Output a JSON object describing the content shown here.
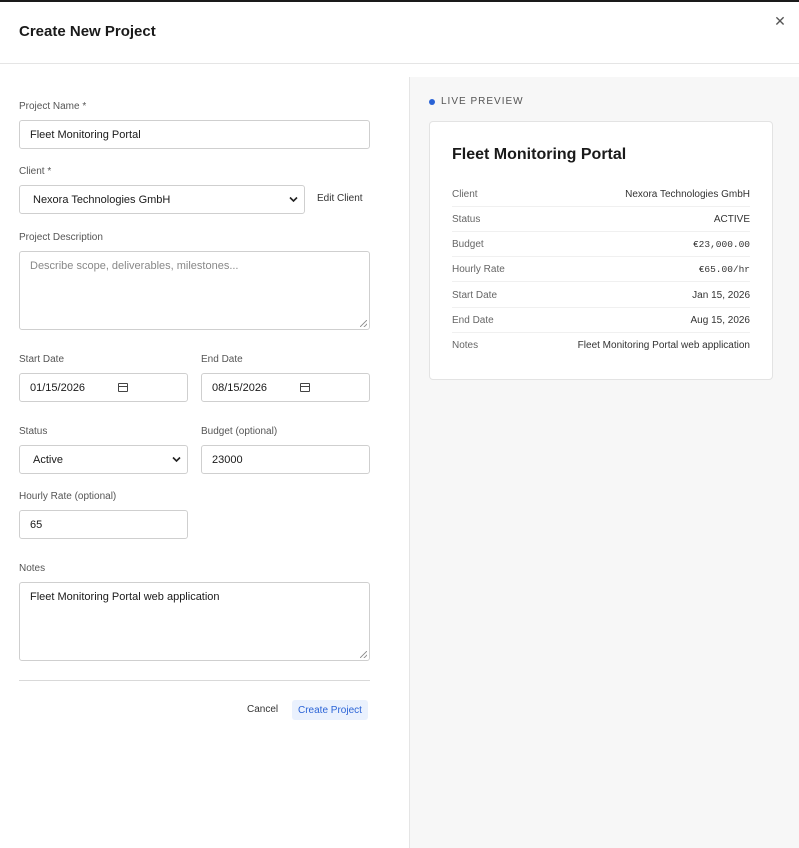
{
  "dialog": {
    "title": "Create New Project",
    "close_icon": "close-icon"
  },
  "form": {
    "project_name": {
      "label": "Project Name *",
      "value": "Fleet Monitoring Portal"
    },
    "client": {
      "label": "Client *",
      "value": "Nexora Technologies GmbH",
      "edit_label": "Edit Client"
    },
    "description": {
      "label": "Project Description",
      "placeholder": "Describe scope, deliverables, milestones..."
    },
    "start_date": {
      "label": "Start Date",
      "value": "01/15/2026"
    },
    "end_date": {
      "label": "End Date",
      "value": "08/15/2026"
    },
    "status": {
      "label": "Status",
      "value": "Active"
    },
    "budget": {
      "label": "Budget (optional)",
      "value": "23000"
    },
    "hourly_rate": {
      "label": "Hourly Rate (optional)",
      "value": "65"
    },
    "notes": {
      "label": "Notes",
      "value": "Fleet Monitoring Portal web application"
    },
    "cancel_label": "Cancel",
    "create_label": "Create Project"
  },
  "preview": {
    "label": "LIVE PREVIEW",
    "title": "Fleet Monitoring Portal",
    "rows": [
      {
        "key": "Client",
        "value": "Nexora Technologies GmbH"
      },
      {
        "key": "Status",
        "value": "ACTIVE"
      },
      {
        "key": "Budget",
        "value": "€23,000.00"
      },
      {
        "key": "Hourly Rate",
        "value": "€65.00/hr"
      },
      {
        "key": "Start Date",
        "value": "Jan 15, 2026"
      },
      {
        "key": "End Date",
        "value": "Aug 15, 2026"
      },
      {
        "key": "Notes",
        "value": "Fleet Monitoring Portal web application"
      }
    ]
  },
  "colors": {
    "accent": "#2a63d6",
    "primary_button_bg": "#eaf1fd"
  }
}
